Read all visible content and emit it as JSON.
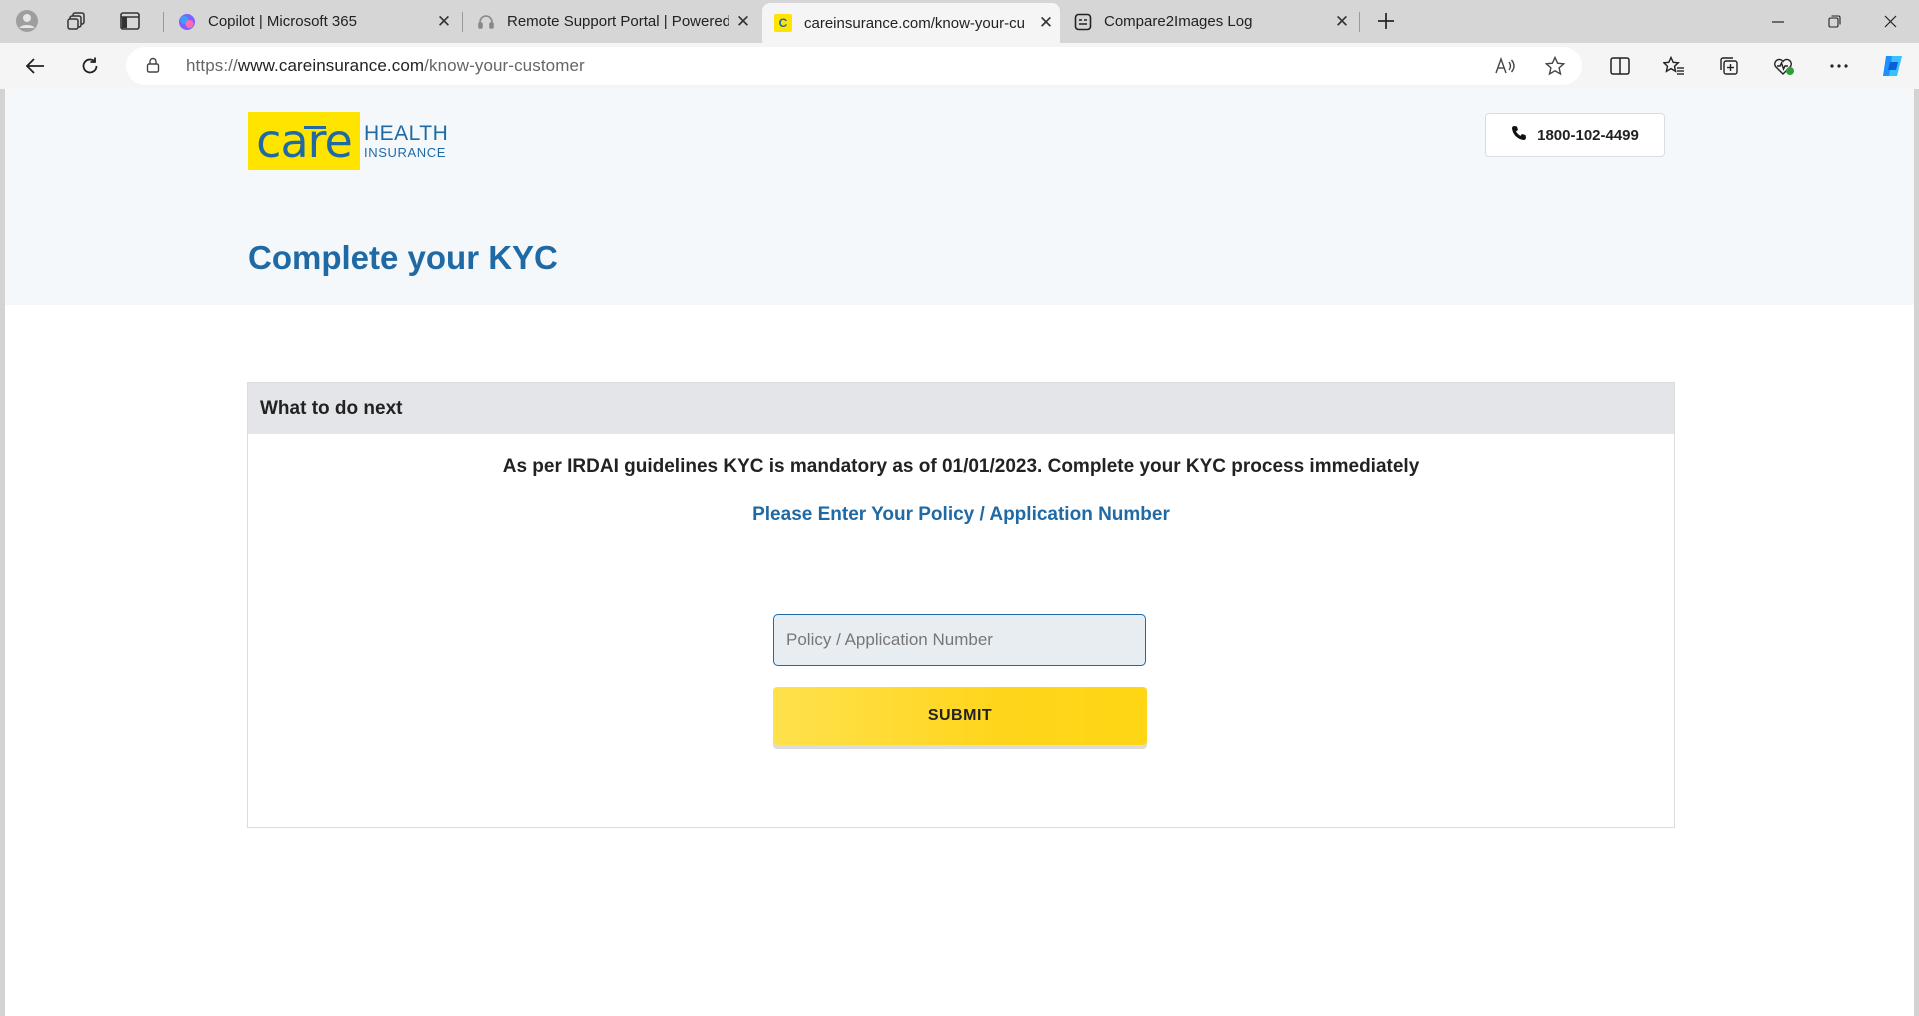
{
  "browser": {
    "tabs": [
      {
        "title": "Copilot | Microsoft 365",
        "favicon": "copilot-icon",
        "active": false
      },
      {
        "title": "Remote Support Portal | Powered",
        "favicon": "headset-icon",
        "active": false
      },
      {
        "title": "careinsurance.com/know-your-cu",
        "favicon": "care-favicon",
        "active": true
      },
      {
        "title": "Compare2Images Log",
        "favicon": "log-icon",
        "active": false
      }
    ],
    "address": {
      "scheme": "https://",
      "host": "www.careinsurance.com",
      "path": "/know-your-customer"
    }
  },
  "header": {
    "logo": {
      "word": "care",
      "line1": "HEALTH",
      "line2": "INSURANCE"
    },
    "phone": "1800-102-4499"
  },
  "page": {
    "title": "Complete your KYC"
  },
  "card": {
    "heading": "What to do next",
    "notice": "As per IRDAI guidelines KYC is mandatory as of 01/01/2023. Complete your KYC process immediately",
    "prompt": "Please Enter Your Policy / Application Number",
    "input": {
      "placeholder": "Policy / Application Number",
      "value": ""
    },
    "submit_label": "SUBMIT"
  },
  "colors": {
    "brand_blue": "#1f6aa5",
    "brand_yellow": "#ffe400",
    "hero_bg": "#f4f8fb",
    "card_head_bg": "#e4e5e8"
  }
}
